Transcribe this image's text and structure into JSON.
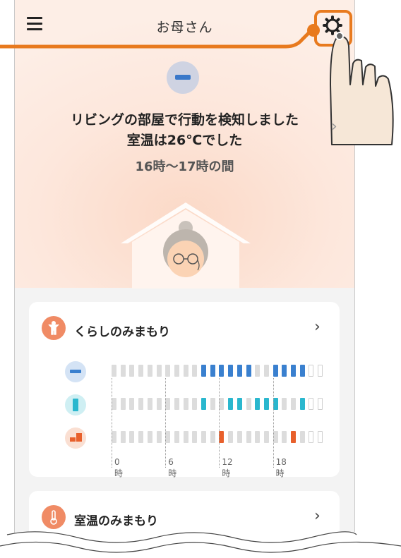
{
  "header": {
    "title": "お母さん"
  },
  "hero": {
    "line1": "リビングの部屋で行動を検知しました",
    "line2": "室温は26℃でした",
    "time_range": "16時～17時の間"
  },
  "cards": [
    {
      "title": "くらしのみまもり",
      "rows": [
        {
          "name": "aircon",
          "color": "#3a80cf",
          "active_slots": [
            10,
            11,
            12,
            13,
            14,
            15,
            18,
            19,
            20,
            21
          ]
        },
        {
          "name": "fridge",
          "color": "#2ab7ce",
          "active_slots": [
            10,
            13,
            14,
            16,
            17,
            18,
            21
          ]
        },
        {
          "name": "microwave",
          "color": "#e8602c",
          "active_slots": [
            12,
            20
          ]
        }
      ],
      "hour_labels": [
        "0時",
        "6時",
        "12時",
        "18時"
      ]
    },
    {
      "title": "室温のみまもり"
    }
  ],
  "colors": {
    "accent": "#e87a1e",
    "inactive_cell": "#dcdcdc",
    "empty_cell_border": "#cfcfcf"
  }
}
